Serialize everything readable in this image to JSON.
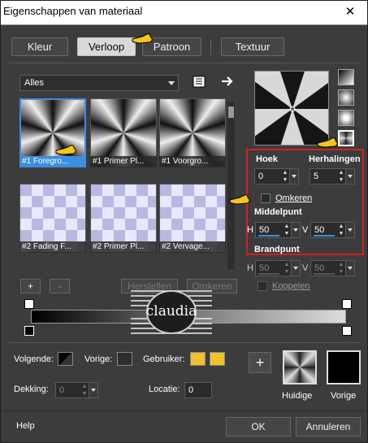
{
  "window": {
    "title": "Eigenschappen van materiaal",
    "close_glyph": "✕"
  },
  "tabs": [
    {
      "label": "Kleur"
    },
    {
      "label": "Verloop"
    },
    {
      "label": "Patroon"
    },
    {
      "label": "Textuur"
    }
  ],
  "gallery": {
    "dropdown": "Alles",
    "items": [
      {
        "label": "#1 Foregro..."
      },
      {
        "label": "#1 Primer Pl..."
      },
      {
        "label": "#1 Voorgro..."
      },
      {
        "label": "#2 Fading F..."
      },
      {
        "label": "#2 Primer Pl..."
      },
      {
        "label": "#2 Vervage..."
      }
    ]
  },
  "settings": {
    "hoek_label": "Hoek",
    "hoek_value": "0",
    "herhalingen_label": "Herhalingen",
    "herhalingen_value": "5",
    "omkeren_label": "Omkeren",
    "middelpunt_label": "Middelpunt",
    "h_label": "H",
    "v_label": "V",
    "mid_h": "50",
    "mid_v": "50",
    "brandpunt_label": "Brandpunt",
    "brand_h": "50",
    "brand_v": "50",
    "koppelen_label": "Koppelen"
  },
  "editor": {
    "add_label": "+",
    "remove_label": "-",
    "herstellen_label": "Herstellen",
    "omkeren_label": "Omkeren",
    "watermark": "claudia"
  },
  "colors_row": {
    "volgende_label": "Volgende:",
    "vorige_label": "Vorige:",
    "gebruiker_label": "Gebruiker:",
    "gebruiker_color": "#f2c12e"
  },
  "opacity": {
    "dekking_label": "Dekking:",
    "dekking_value": "0",
    "locatie_label": "Locatie:",
    "locatie_value": "0"
  },
  "swatches": {
    "add_label": "+",
    "huidige_label": "Huidige",
    "vorige_label": "Vorige"
  },
  "footer": {
    "help_label": "Help",
    "ok_label": "OK",
    "cancel_label": "Annuleren"
  },
  "colors": {
    "accent": "#3d8ee0",
    "highlight_box": "#d32020",
    "pointer": "#f5c518"
  }
}
